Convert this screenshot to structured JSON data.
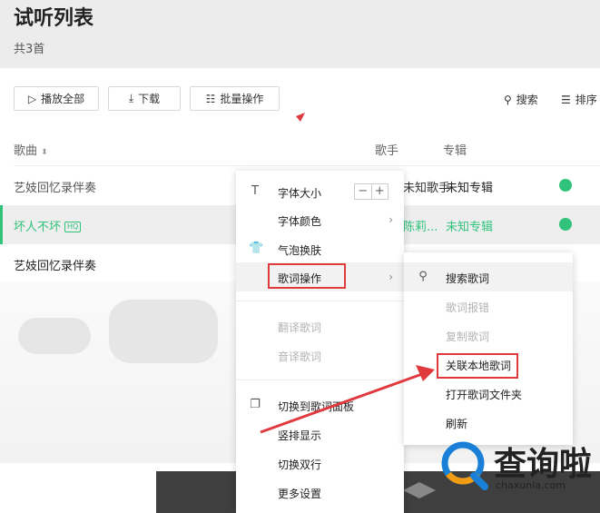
{
  "header": {
    "title": "试听列表",
    "count_text": "共3首"
  },
  "toolbar": {
    "play_all": "播放全部",
    "download": "下载",
    "batch": "批量操作",
    "search": "搜索",
    "sort": "排序"
  },
  "columns": {
    "song": "歌曲",
    "artist": "歌手",
    "album": "专辑"
  },
  "songs": [
    {
      "name": "艺妓回忆录伴奏",
      "artist": "未知歌手",
      "album": "未知专辑",
      "downloaded": true
    },
    {
      "name": "坏人不坏",
      "badge": "HQ",
      "artist": "陈莉...",
      "album": "未知专辑",
      "downloaded": true
    },
    {
      "name": "艺妓回忆录伴奏",
      "artist": "",
      "album": "",
      "downloaded": false
    }
  ],
  "context_menu": {
    "items": [
      {
        "label": "字体大小",
        "icon": "text-size-icon",
        "stepper_minus": "−",
        "stepper_plus": "+"
      },
      {
        "label": "字体颜色",
        "arrow": "›"
      },
      {
        "label": "气泡换肤",
        "icon": "shirt-icon"
      },
      {
        "label": "歌词操作",
        "arrow": "›",
        "highlighted": true
      },
      {
        "label": "翻译歌词",
        "disabled": true
      },
      {
        "label": "音译歌词",
        "disabled": true
      },
      {
        "label": "切换到歌词面板",
        "icon": "panel-icon"
      },
      {
        "label": "竖排显示"
      },
      {
        "label": "切换双行"
      },
      {
        "label": "更多设置"
      }
    ]
  },
  "submenu": {
    "items": [
      {
        "label": "搜索歌词",
        "icon": "search-icon"
      },
      {
        "label": "歌词报错",
        "disabled": true
      },
      {
        "label": "复制歌词",
        "disabled": true
      },
      {
        "label": "关联本地歌词",
        "highlighted": true
      },
      {
        "label": "打开歌词文件夹"
      },
      {
        "label": "刷新"
      }
    ]
  },
  "watermark": {
    "brand": "查询啦",
    "url": "chaxunla.com"
  },
  "colors": {
    "accent": "#31c27c",
    "annotation": "#e0393e",
    "player_bg": "#3f3f3f"
  }
}
